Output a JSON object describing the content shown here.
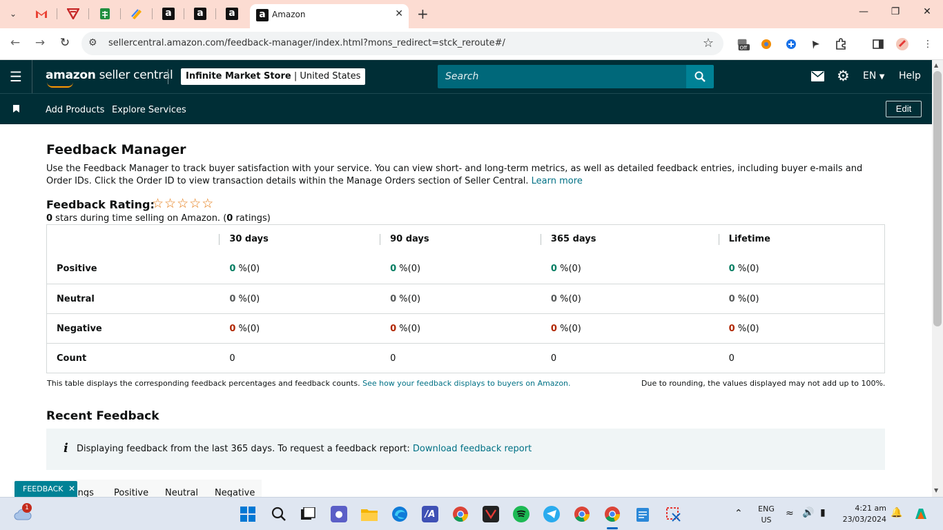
{
  "browser": {
    "active_tab_title": "Amazon",
    "url": "sellercentral.amazon.com/feedback-manager/index.html?mons_redirect=stck_reroute#/"
  },
  "header": {
    "logo_strong": "amazon",
    "logo_rest": " seller central",
    "store_name": "Infinite Market Store",
    "store_region": "United States",
    "search_placeholder": "Search",
    "language": "EN",
    "help": "Help"
  },
  "subnav": {
    "add_products": "Add Products",
    "explore_services": "Explore Services",
    "edit": "Edit"
  },
  "page": {
    "title": "Feedback Manager",
    "intro": "Use the Feedback Manager to track buyer satisfaction with your service. You can view short- and long-term metrics, as well as detailed feedback entries, including buyer e-mails and Order IDs. Click the Order ID to view transaction details within the Manage Orders section of Seller Central.",
    "learn_more": "Learn more",
    "rating_label": "Feedback Rating:",
    "rating_stars": 0,
    "stars_value": "0",
    "stars_text": " stars during time selling on Amazon. (",
    "ratings_count": "0",
    "ratings_suffix": " ratings)"
  },
  "table": {
    "headers": [
      "",
      "30 days",
      "90 days",
      "365 days",
      "Lifetime"
    ],
    "rows": [
      {
        "label": "Positive",
        "cls": "pos",
        "cells": [
          {
            "n": "0",
            "s": " %(0)"
          },
          {
            "n": "0",
            "s": " %(0)"
          },
          {
            "n": "0",
            "s": " %(0)"
          },
          {
            "n": "0",
            "s": " %(0)"
          }
        ]
      },
      {
        "label": "Neutral",
        "cls": "neu",
        "cells": [
          {
            "n": "0",
            "s": " %(0)"
          },
          {
            "n": "0",
            "s": " %(0)"
          },
          {
            "n": "0",
            "s": " %(0)"
          },
          {
            "n": "0",
            "s": " %(0)"
          }
        ]
      },
      {
        "label": "Negative",
        "cls": "neg",
        "cells": [
          {
            "n": "0",
            "s": " %(0)"
          },
          {
            "n": "0",
            "s": " %(0)"
          },
          {
            "n": "0",
            "s": " %(0)"
          },
          {
            "n": "0",
            "s": " %(0)"
          }
        ]
      },
      {
        "label": "Count",
        "cls": "",
        "cells": [
          {
            "n": "0",
            "s": ""
          },
          {
            "n": "0",
            "s": ""
          },
          {
            "n": "0",
            "s": ""
          },
          {
            "n": "0",
            "s": ""
          }
        ]
      }
    ],
    "note_left": "This table displays the corresponding feedback percentages and feedback counts. ",
    "note_left_link": "See how your feedback displays to buyers on Amazon.",
    "note_right": "Due to rounding, the values displayed may not add up to 100%."
  },
  "recent": {
    "title": "Recent Feedback",
    "alert_text": "Displaying feedback from the last 365 days. To request a feedback report: ",
    "alert_link": "Download feedback report",
    "tabs": [
      "ings",
      "Positive",
      "Neutral",
      "Negative"
    ],
    "feedback_pill": "FEEDBACK"
  },
  "taskbar": {
    "weather_badge": "1",
    "lang_top": "ENG",
    "lang_bottom": "US",
    "time": "4:21 am",
    "date": "23/03/2024"
  },
  "colors": {
    "header_bg": "#002e36",
    "search_bg": "#00687a",
    "link": "#007185",
    "positive": "#067d62",
    "negative": "#b12704"
  }
}
